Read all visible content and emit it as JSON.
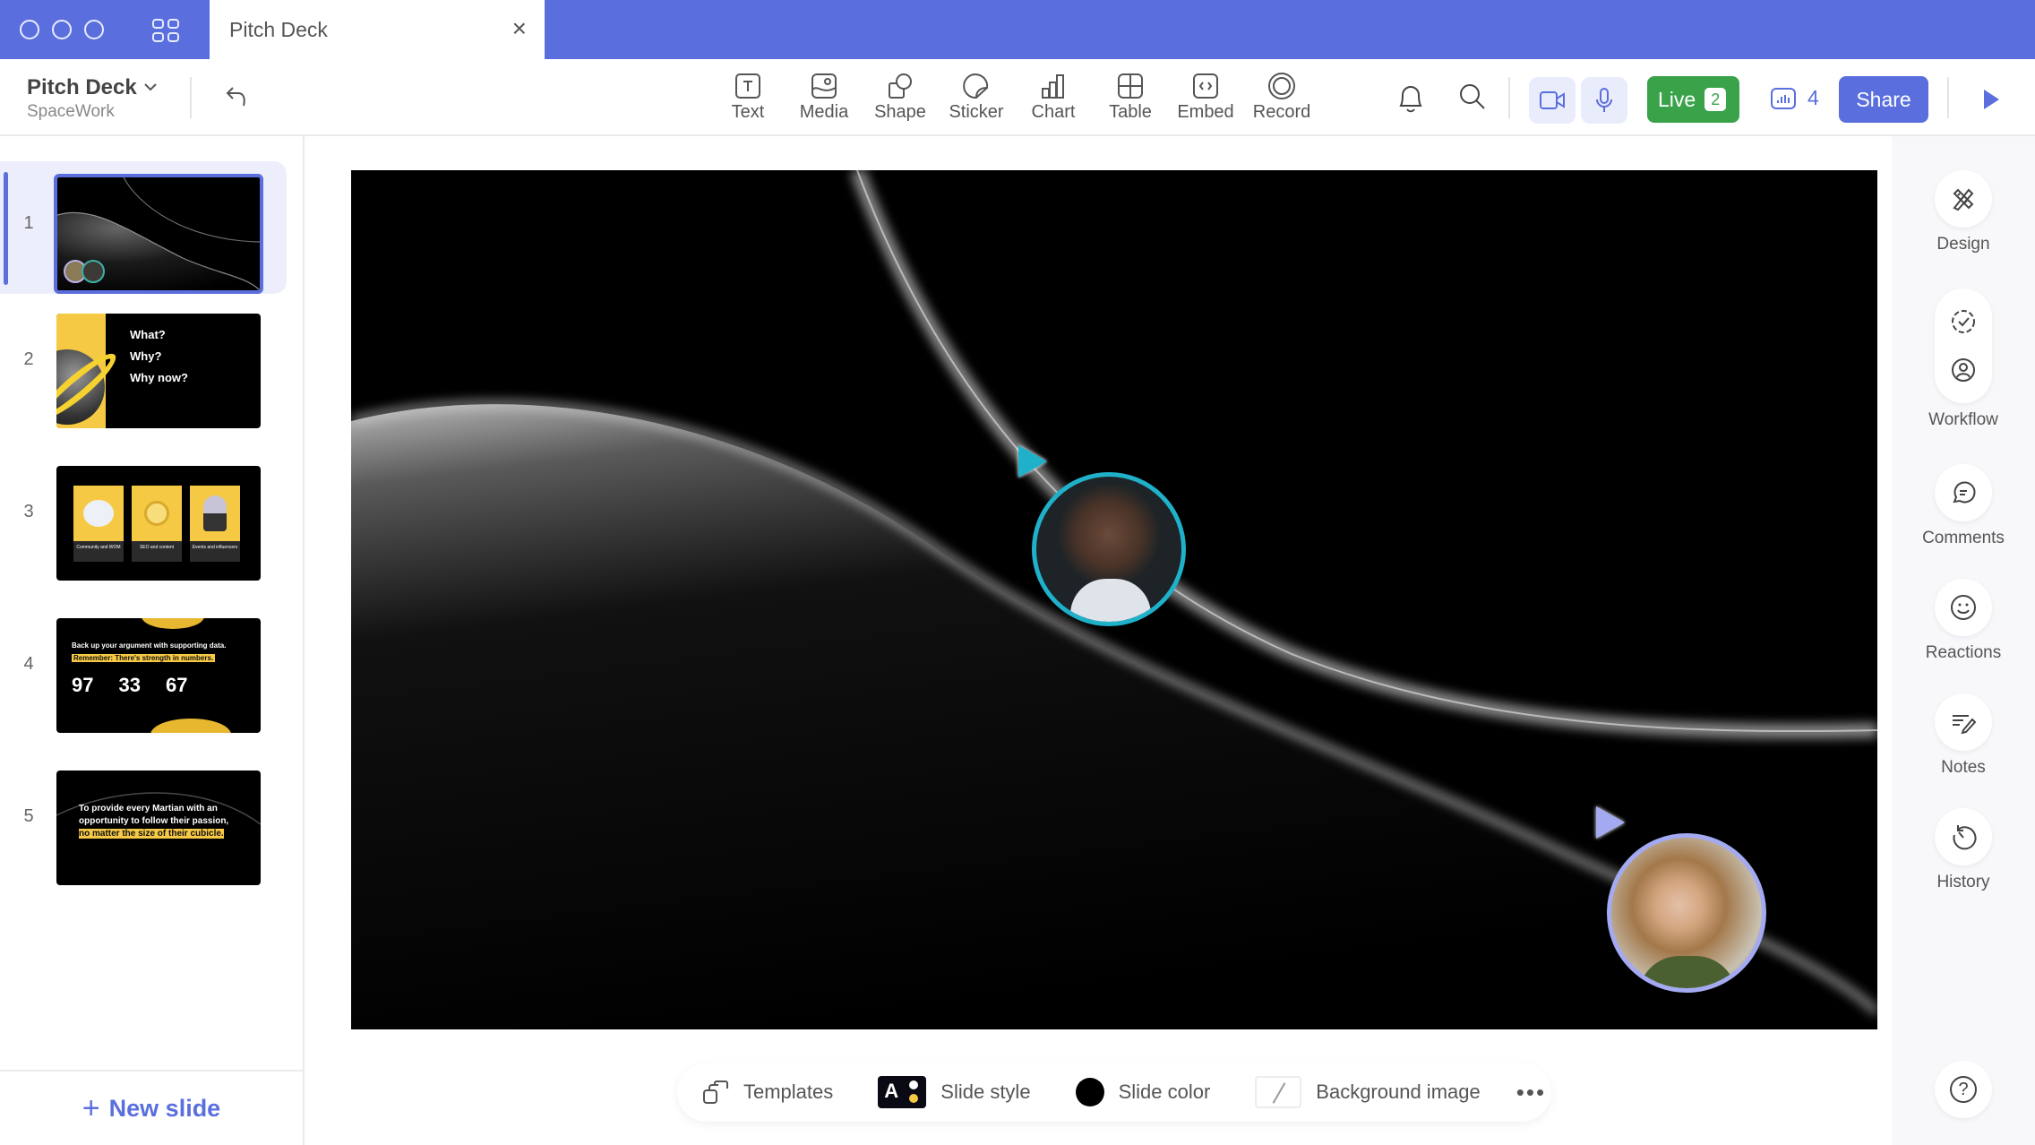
{
  "window": {
    "tab_title": "Pitch Deck",
    "accent": "#5a6fdd"
  },
  "header": {
    "doc_title": "Pitch Deck",
    "workspace": "SpaceWork",
    "tools": [
      {
        "label": "Text",
        "icon": "text-icon"
      },
      {
        "label": "Media",
        "icon": "media-icon"
      },
      {
        "label": "Shape",
        "icon": "shape-icon"
      },
      {
        "label": "Sticker",
        "icon": "sticker-icon"
      },
      {
        "label": "Chart",
        "icon": "chart-icon"
      },
      {
        "label": "Table",
        "icon": "table-icon"
      },
      {
        "label": "Embed",
        "icon": "embed-icon"
      },
      {
        "label": "Record",
        "icon": "record-icon"
      }
    ],
    "live_label": "Live",
    "live_count": "2",
    "analytics_count": "4",
    "share_label": "Share"
  },
  "sidebar": {
    "slides": [
      {
        "number": "1",
        "selected": true
      },
      {
        "number": "2",
        "lines": [
          "What?",
          "Why?",
          "Why now?"
        ]
      },
      {
        "number": "3",
        "cards": [
          "Community and WOM",
          "SEO and content",
          "Events and influencers"
        ]
      },
      {
        "number": "4",
        "headline": "Back up your argument with supporting data.",
        "highlight": "Remember: There's strength in numbers.",
        "stats": [
          "97",
          "33",
          "67"
        ]
      },
      {
        "number": "5",
        "text": "To provide every Martian with an opportunity to follow their passion,",
        "highlight": "no matter the size of their cubicle."
      }
    ],
    "new_slide_label": "New slide"
  },
  "bottom_bar": {
    "templates": "Templates",
    "slide_style": "Slide style",
    "slide_style_letter": "A",
    "slide_color": "Slide color",
    "background_image": "Background image",
    "more": "•••"
  },
  "right_panel": {
    "design": "Design",
    "workflow": "Workflow",
    "comments": "Comments",
    "reactions": "Reactions",
    "notes": "Notes",
    "history": "History",
    "help": "?"
  },
  "collaborators": [
    {
      "name": "collaborator-1",
      "color": "#1fb1c9"
    },
    {
      "name": "collaborator-2",
      "color": "#a4aaf2"
    }
  ]
}
